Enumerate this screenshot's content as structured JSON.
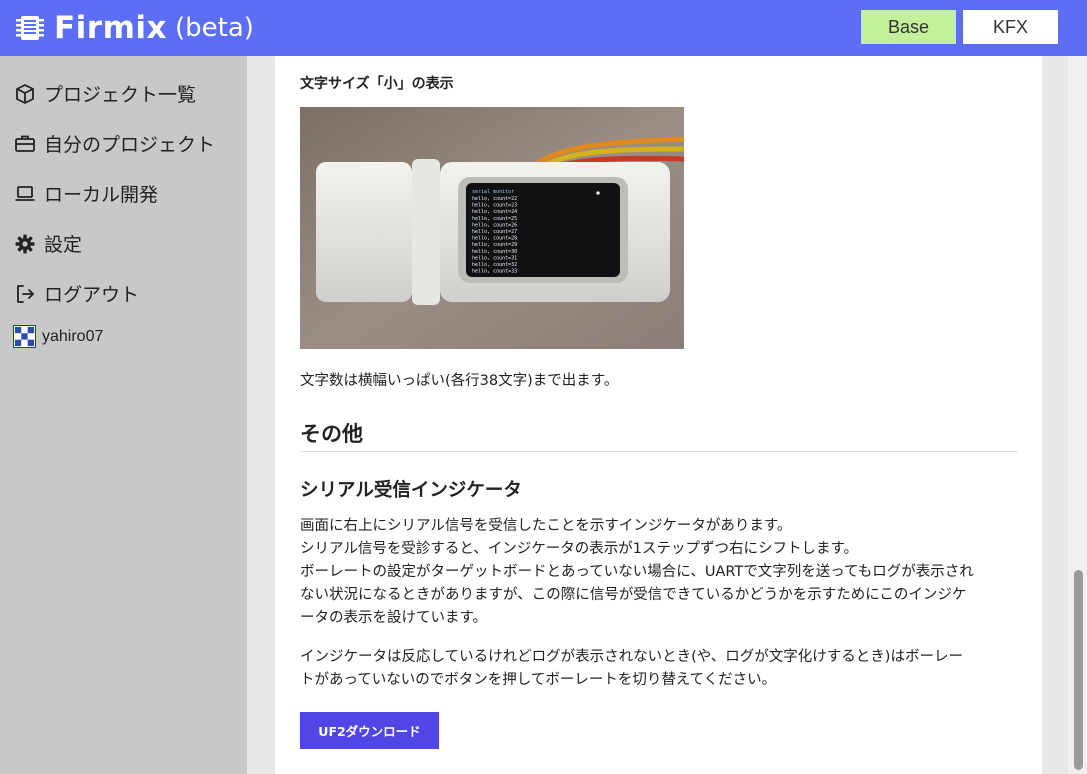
{
  "header": {
    "brand_name": "Firmix",
    "brand_suffix": "(beta)",
    "brand_icon": "chip-icon",
    "buttons": [
      {
        "label": "Base",
        "active": true
      },
      {
        "label": "KFX",
        "active": false
      }
    ],
    "accent_color": "#5b6ef5",
    "active_button_color": "#c3f09b"
  },
  "sidebar": {
    "items": [
      {
        "label": "プロジェクト一覧",
        "icon": "cube-icon"
      },
      {
        "label": "自分のプロジェクト",
        "icon": "briefcase-icon"
      },
      {
        "label": "ローカル開発",
        "icon": "laptop-icon"
      },
      {
        "label": "設定",
        "icon": "gear-icon"
      },
      {
        "label": "ログアウト",
        "icon": "logout-icon"
      }
    ],
    "user": {
      "name": "yahiro07",
      "icon": "avatar"
    }
  },
  "main": {
    "small_heading": "文字サイズ「小」の表示",
    "image": {
      "description_icon": "device-photo",
      "screen_title": "serial monitor",
      "screen_lines": [
        "hello, count=22",
        "hello, count=23",
        "hello, count=24",
        "hello, count=25",
        "hello, count=26",
        "hello, count=27",
        "hello, count=28",
        "hello, count=29",
        "hello, count=30",
        "hello, count=31",
        "hello, count=32",
        "hello, count=33"
      ]
    },
    "paragraph1": "文字数は横幅いっぱい(各行38文字)まで出ます。",
    "section_title": "その他",
    "subsection_title": "シリアル受信インジケータ",
    "paragraph2_lines": [
      "画面に右上にシリアル信号を受信したことを示すインジケータがあります。",
      "シリアル信号を受診すると、インジケータの表示が1ステップずつ右にシフトします。",
      "ボーレートの設定がターゲットボードとあっていない場合に、UARTで文字列を送ってもログが表示され",
      "ない状況になるときがありますが、この際に信号が受信できているかどうかを示すためにこのインジケ",
      "ータの表示を設けています。"
    ],
    "paragraph3_lines": [
      "インジケータは反応しているけれどログが表示されないとき(や、ログが文字化けするとき)はボーレー",
      "トがあっていないのでボタンを押してボーレートを切り替えてください。"
    ],
    "download_button": "UF2ダウンロード",
    "download_button_color": "#4f46e5"
  }
}
